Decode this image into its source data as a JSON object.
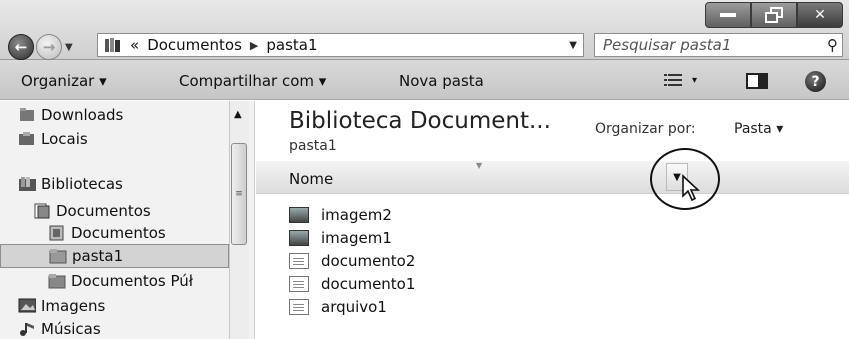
{
  "window": {
    "address": {
      "parent_chevron": "«",
      "segment1": "Documentos",
      "separator": "▶",
      "segment2": "pasta1"
    },
    "search": {
      "placeholder": "Pesquisar pasta1"
    },
    "caption_buttons": [
      "minimize-icon",
      "restore-icon",
      "close-icon"
    ]
  },
  "toolbar": {
    "organize_label": "Organizar ▾",
    "share_label": "Compartilhar com ▾",
    "new_folder_label": "Nova pasta",
    "view_dd": "▾"
  },
  "navpane": {
    "items": [
      {
        "label": "Downloads",
        "icon": "downloads-icon"
      },
      {
        "label": "Locais",
        "icon": "places-icon"
      },
      {
        "label": "Bibliotecas",
        "icon": "libraries-icon"
      },
      {
        "label": "Documentos",
        "icon": "documents-library-icon"
      },
      {
        "label": "Documentos",
        "icon": "documents-folder-icon"
      },
      {
        "label": "pasta1",
        "icon": "folder-icon",
        "selected": true
      },
      {
        "label": "Documentos Púł",
        "icon": "public-documents-icon"
      },
      {
        "label": "Imagens",
        "icon": "images-icon"
      },
      {
        "label": "Músicas",
        "icon": "music-icon"
      }
    ]
  },
  "content": {
    "title": "Biblioteca Document...",
    "subtitle": "pasta1",
    "arrange_by_label": "Organizar por:",
    "arrange_by_value": "Pasta ▾",
    "column_name": "Nome",
    "files": [
      {
        "name": "imagem2",
        "type": "image"
      },
      {
        "name": "imagem1",
        "type": "image"
      },
      {
        "name": "documento2",
        "type": "doc"
      },
      {
        "name": "documento1",
        "type": "doc"
      },
      {
        "name": "arquivo1",
        "type": "doc"
      }
    ]
  }
}
